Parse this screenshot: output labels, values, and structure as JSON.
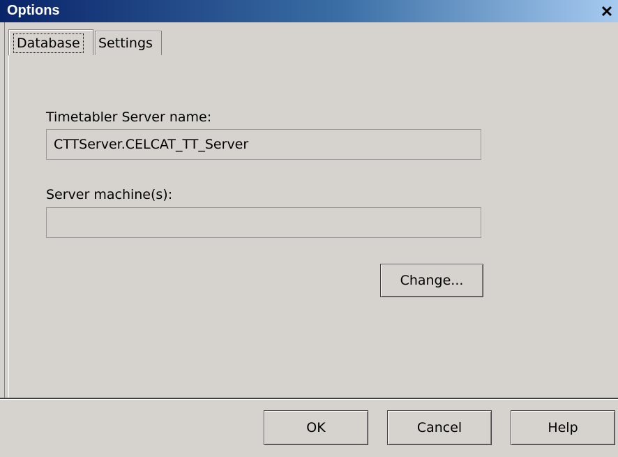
{
  "window": {
    "title": "Options",
    "close_glyph": "✕"
  },
  "tabs": [
    {
      "label": "Database",
      "active": true
    },
    {
      "label": "Settings",
      "active": false
    }
  ],
  "database": {
    "server_name_label": "Timetabler Server name:",
    "server_name_value": "CTTServer.CELCAT_TT_Server",
    "machines_label": "Server machine(s):",
    "machines_value": "",
    "change_label": "Change..."
  },
  "footer": {
    "ok_label": "OK",
    "cancel_label": "Cancel",
    "help_label": "Help"
  },
  "icons": {
    "close": "close-icon"
  }
}
